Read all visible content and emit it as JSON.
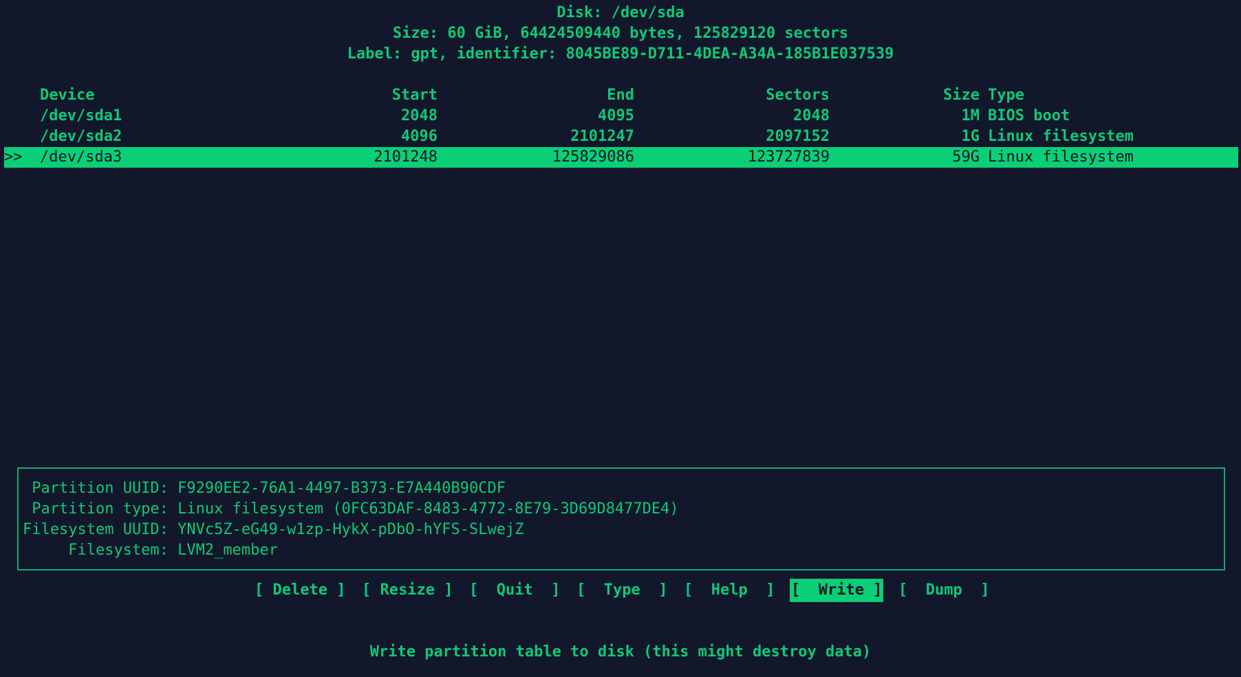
{
  "header": {
    "disk": "Disk: /dev/sda",
    "size": "Size: 60 GiB, 64424509440 bytes, 125829120 sectors",
    "label": "Label: gpt, identifier: 8045BE89-D711-4DEA-A34A-185B1E037539"
  },
  "table": {
    "columns": {
      "device": "Device",
      "start": "Start",
      "end": "End",
      "sectors": "Sectors",
      "size": "Size",
      "type": "Type"
    },
    "rows": [
      {
        "marker": "",
        "device": "/dev/sda1",
        "start": "2048",
        "end": "4095",
        "sectors": "2048",
        "size": "1M",
        "type": "BIOS boot"
      },
      {
        "marker": "",
        "device": "/dev/sda2",
        "start": "4096",
        "end": "2101247",
        "sectors": "2097152",
        "size": "1G",
        "type": "Linux filesystem"
      },
      {
        "marker": ">>",
        "device": "/dev/sda3",
        "start": "2101248",
        "end": "125829086",
        "sectors": "123727839",
        "size": "59G",
        "type": "Linux filesystem"
      }
    ]
  },
  "info": {
    "partition_uuid": " Partition UUID: F9290EE2-76A1-4497-B373-E7A440B90CDF",
    "partition_type": " Partition type: Linux filesystem (0FC63DAF-8483-4772-8E79-3D69D8477DE4)",
    "filesystem_uuid": "Filesystem UUID: YNVc5Z-eG49-w1zp-HykX-pDbO-hYFS-SLwejZ",
    "filesystem": "     Filesystem: LVM2_member"
  },
  "buttons": {
    "delete": "[ Delete ]",
    "resize": "[ Resize ]",
    "quit": "[  Quit  ]",
    "type": "[  Type  ]",
    "help": "[  Help  ]",
    "write": "[  Write ]",
    "dump": "[  Dump  ]"
  },
  "status": "Write partition table to disk (this might destroy data)",
  "colors": {
    "background": "#13172b",
    "foreground": "#11c877",
    "highlight": "#0bcf76"
  }
}
